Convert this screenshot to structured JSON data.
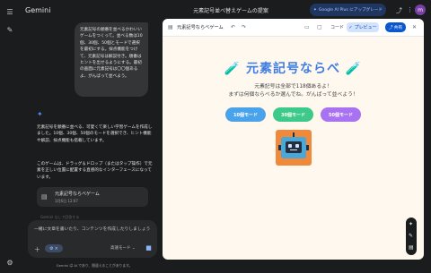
{
  "header": {
    "brand": "Gemini",
    "title": "元素記号並べ替えゲームの提案",
    "upgrade_label": "Google AI Plus にアップグレード",
    "avatar_letter": "m"
  },
  "rail": {
    "icons": [
      "menu-icon",
      "new-chat-icon",
      "settings-icon"
    ]
  },
  "chat": {
    "user_message": "元素記号の順番を並べるかわいいゲームをつくって。並べる数は10個、30個、50個とモードで選択を最初にする。採点機能をつけて、元素記号は解説付き。順番はヒントを出せるようにする。最初の画面に元素記号は〇〇個あるよ、がんばって並べよう。",
    "response_p1": "元素記号を順番に並べる、可愛くて楽しい学習ゲームを作成しました。10個、30個、50個のモードを選択でき、ヒント機能や解説、採点機能も搭載しています。",
    "response_p2": "このゲームは、ドラッグ＆ドロップ（またはタップ操作）で元素を正しい位置に配置する直感的なインターフェースになっています。",
    "card_title": "元素記号ならべゲーム",
    "card_date": "3月6日 12:07",
    "faint_text": "Gemini なしで回答する"
  },
  "prompt": {
    "placeholder": "一緒に文章を書いたり、コンテンツを作成したりしましょう",
    "tools_label": "≡",
    "mode_label": "高速モード ⌄"
  },
  "disclaimer": "Gemini は AI であり、間違えることがあります。",
  "panel": {
    "title": "元素記号ならべゲーム",
    "code_label": "コード",
    "preview_label": "プレビュー",
    "share_label": "共有"
  },
  "game": {
    "title": "元素記号ならべ",
    "line1": "元素記号は全部で118個あるよ！",
    "line2": "まずは何個ならべるか選んでね。がんばって並べよう！",
    "modes": [
      {
        "label": "10個モード",
        "color": "#4aa3ea"
      },
      {
        "label": "30個モード",
        "color": "#3dc98a"
      },
      {
        "label": "50個モード",
        "color": "#a872f0"
      }
    ]
  }
}
